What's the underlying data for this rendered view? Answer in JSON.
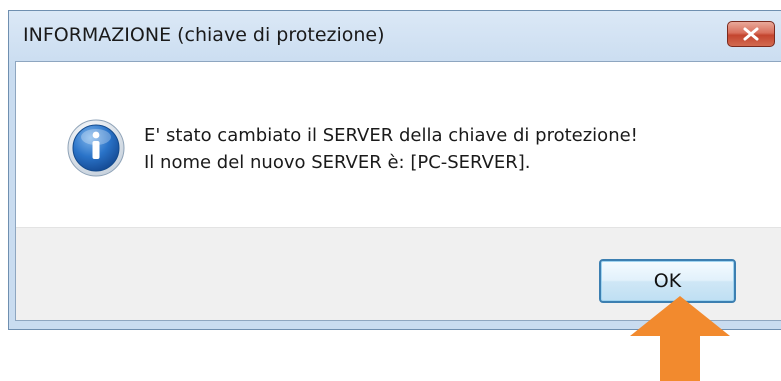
{
  "dialog": {
    "title": "INFORMAZIONE (chiave di protezione)",
    "close_icon": "close-icon",
    "info_icon": "information-icon",
    "message_line1": "E' stato cambiato il SERVER della chiave di protezione!",
    "message_line2": "Il nome del nuovo SERVER è: [PC-SERVER].",
    "ok_label": "OK"
  },
  "annotation": {
    "arrow_icon": "arrow-up-icon",
    "arrow_color": "#f28a2e"
  },
  "colors": {
    "close_button": "#c4452f",
    "info_icon_blue": "#1b5fb0",
    "ok_border": "#3c7fb1"
  }
}
